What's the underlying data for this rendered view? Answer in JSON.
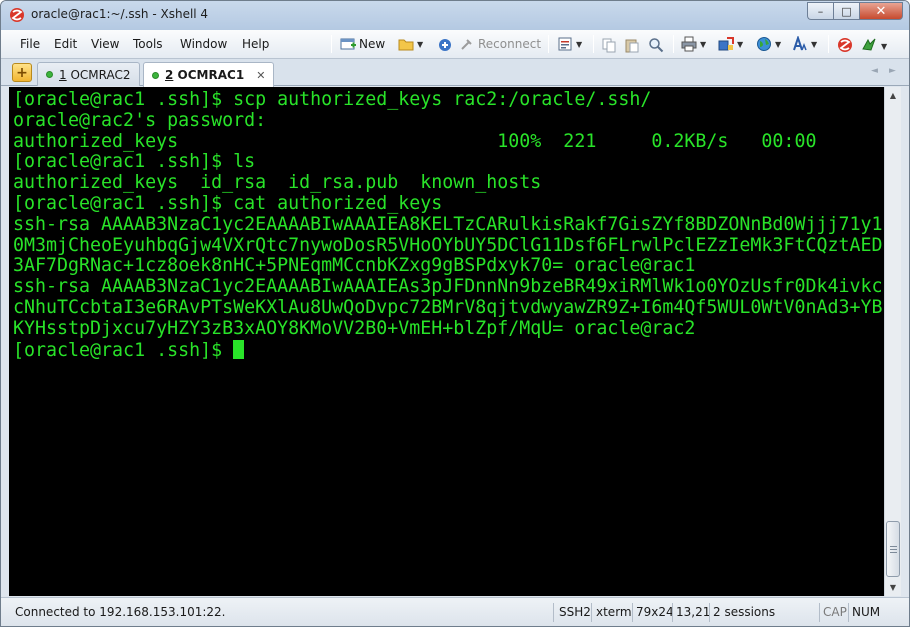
{
  "window": {
    "title": "oracle@rac1:~/.ssh - Xshell 4",
    "minimize_glyph": "–",
    "maximize_glyph": "□",
    "close_glyph": "✕"
  },
  "menu": [
    "File",
    "Edit",
    "View",
    "Tools",
    "Window",
    "Help"
  ],
  "toolbar": {
    "new_label": "New",
    "reconnect_label": "Reconnect"
  },
  "tabs": [
    {
      "number": "1",
      "name": "OCMRAC2",
      "active": false
    },
    {
      "number": "2",
      "name": "OCMRAC1",
      "active": true
    }
  ],
  "tab_close_glyph": "✕",
  "tab_add_glyph": "+",
  "terminal": {
    "lines": [
      "[oracle@rac1 .ssh]$ scp authorized_keys rac2:/oracle/.ssh/",
      "oracle@rac2's password: ",
      "authorized_keys                             100%  221     0.2KB/s   00:00    ",
      "[oracle@rac1 .ssh]$ ls",
      "authorized_keys  id_rsa  id_rsa.pub  known_hosts",
      "[oracle@rac1 .ssh]$ cat authorized_keys",
      "ssh-rsa AAAAB3NzaC1yc2EAAAABIwAAAIEA8KELTzCARulkisRakf7GisZYf8BDZONnBd0Wjjj71y1",
      "0M3mjCheoEyuhbqGjw4VXrQtc7nywoDosR5VHoOYbUY5DClG11Dsf6FLrwlPclEZzIeMk3FtCQztAED",
      "3AF7DgRNac+1cz8oek8nHC+5PNEqmMCcnbKZxg9gBSPdxyk70= oracle@rac1",
      "ssh-rsa AAAAB3NzaC1yc2EAAAABIwAAAIEAs3pJFDnnNn9bzeBR49xiRMlWk1o0YOzUsfr0Dk4ivkc",
      "cNhuTCcbtaI3e6RAvPTsWeKXlAu8UwQoDvpc72BMrV8qjtvdwyawZR9Z+I6m4Qf5WUL0WtV0nAd3+YB",
      "KYHsstpDjxcu7yHZY3zB3xAOY8KMoVV2B0+VmEH+blZpf/MqU= oracle@rac2",
      "[oracle@rac1 .ssh]$ "
    ]
  },
  "statusbar": {
    "connection": "Connected to 192.168.153.101:22.",
    "protocol": "SSH2",
    "terminal_type": "xterm",
    "size": "79x24",
    "cursor_pos": "13,21",
    "sessions": "2 sessions",
    "caps": "CAP",
    "num": "NUM"
  },
  "colors": {
    "terminal_fg": "#29e329",
    "terminal_bg": "#000000"
  }
}
